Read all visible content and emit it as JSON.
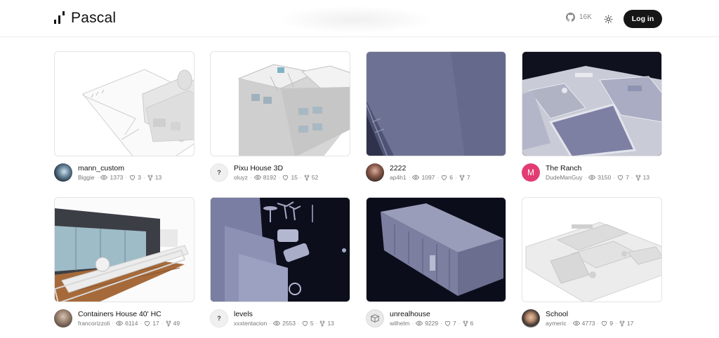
{
  "header": {
    "logo_text": "Pascal",
    "github_stars": "16K",
    "login_label": "Log in"
  },
  "projects": [
    {
      "title": "mann_custom",
      "author": "Biggie",
      "views": "1373",
      "likes": "3",
      "forks": "13",
      "avatar": "photo"
    },
    {
      "title": "Pixu House 3D",
      "author": "oluyz",
      "views": "8192",
      "likes": "15",
      "forks": "52",
      "avatar": "?"
    },
    {
      "title": "2222",
      "author": "ap4h1",
      "views": "1097",
      "likes": "6",
      "forks": "7",
      "avatar": "photo"
    },
    {
      "title": "The Ranch",
      "author": "DudeManGuy",
      "views": "3150",
      "likes": "7",
      "forks": "13",
      "avatar": "M"
    },
    {
      "title": "Containers House 40' HC",
      "author": "francorizzoli",
      "views": "6114",
      "likes": "17",
      "forks": "49",
      "avatar": "photo"
    },
    {
      "title": "levels",
      "author": "xxxtentacion",
      "views": "2553",
      "likes": "5",
      "forks": "13",
      "avatar": "?"
    },
    {
      "title": "unrealhouse",
      "author": "wilhelm",
      "views": "9229",
      "likes": "7",
      "forks": "6",
      "avatar": "photo"
    },
    {
      "title": "School",
      "author": "aymeric",
      "views": "4773",
      "likes": "9",
      "forks": "17",
      "avatar": "photo"
    }
  ]
}
